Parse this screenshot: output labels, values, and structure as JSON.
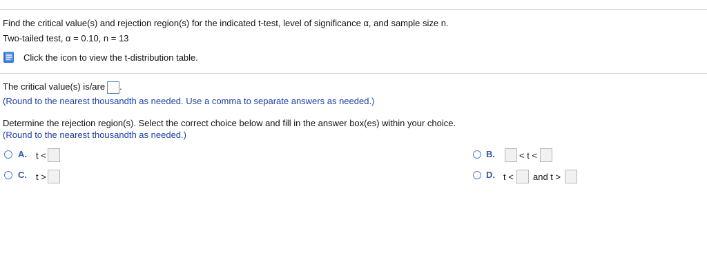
{
  "question": {
    "line1": "Find the critical value(s) and rejection region(s) for the indicated t-test, level of significance α, and sample size n.",
    "line2": "Two-tailed test, α = 0.10, n = 13",
    "table_link": "Click the icon to view the t-distribution table."
  },
  "part1": {
    "prompt": "The critical value(s) is/are",
    "period": ".",
    "hint": "(Round to the nearest thousandth as needed. Use a comma to separate answers as needed.)"
  },
  "part2": {
    "prompt": "Determine the rejection region(s). Select the correct choice below and fill in the answer box(es) within your choice.",
    "hint": "(Round to the nearest thousandth as needed.)"
  },
  "choices": {
    "a": {
      "letter": "A.",
      "text": "t <"
    },
    "b": {
      "letter": "B.",
      "mid": "< t <"
    },
    "c": {
      "letter": "C.",
      "text": "t >"
    },
    "d": {
      "letter": "D.",
      "text1": "t <",
      "text2": "and t >"
    }
  },
  "colors": {
    "hint_blue": "#1a3fa6",
    "radio_blue": "#4a7fd6",
    "icon_blue": "#2f6fd6"
  },
  "icons": {
    "table_icon": "book-icon"
  }
}
